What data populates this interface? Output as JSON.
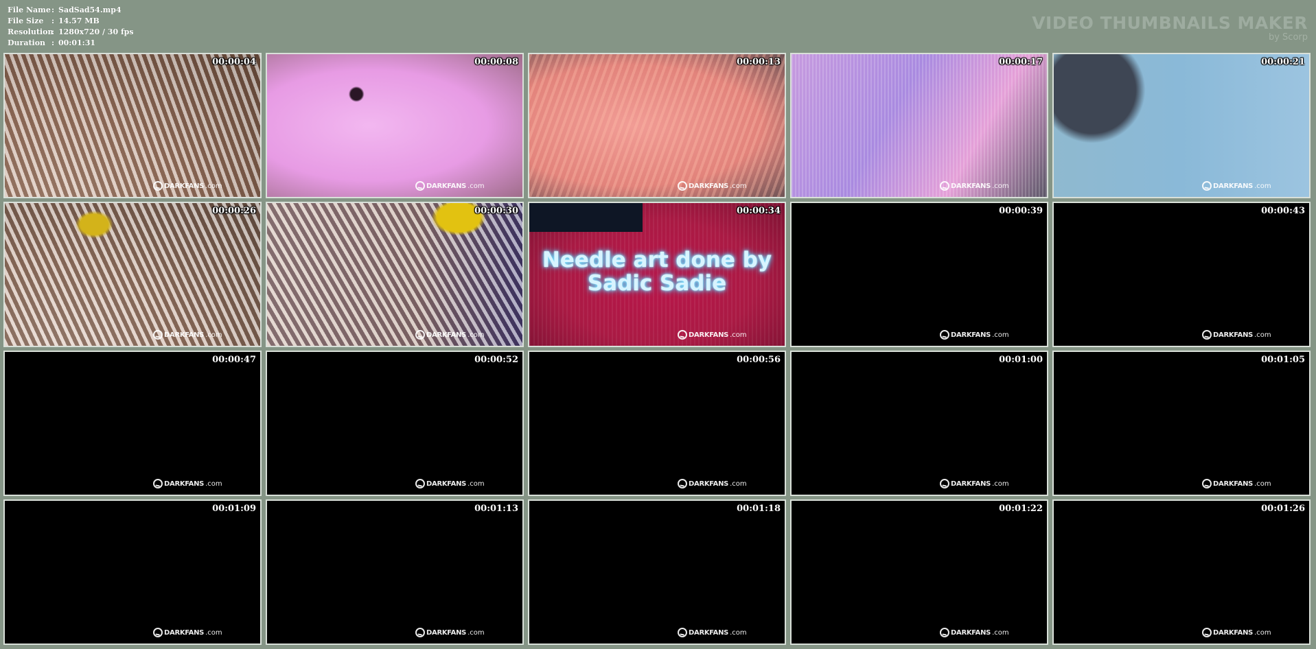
{
  "info": [
    {
      "key": "File Name",
      "sep": ":",
      "value": "SadSad54.mp4"
    },
    {
      "key": "File Size",
      "sep": ":",
      "value": "14.57 MB"
    },
    {
      "key": "Resolution",
      "sep": ":",
      "value": "1280x720 / 30 fps"
    },
    {
      "key": "Duration",
      "sep": ":",
      "value": "00:01:31"
    }
  ],
  "brand": {
    "title": "VIDEO THUMBNAILS MAKER",
    "subtitle": "by Scorp"
  },
  "watermark": {
    "dark": "DARKFANS",
    "rest": ".com"
  },
  "caption": {
    "line1": "Needle art done by",
    "line2": "Sadic Sadie"
  },
  "thumbnails": [
    {
      "time": "00:00:04"
    },
    {
      "time": "00:00:08"
    },
    {
      "time": "00:00:13"
    },
    {
      "time": "00:00:17"
    },
    {
      "time": "00:00:21"
    },
    {
      "time": "00:00:26"
    },
    {
      "time": "00:00:30"
    },
    {
      "time": "00:00:34"
    },
    {
      "time": "00:00:39"
    },
    {
      "time": "00:00:43"
    },
    {
      "time": "00:00:47"
    },
    {
      "time": "00:00:52"
    },
    {
      "time": "00:00:56"
    },
    {
      "time": "00:01:00"
    },
    {
      "time": "00:01:05"
    },
    {
      "time": "00:01:09"
    },
    {
      "time": "00:01:13"
    },
    {
      "time": "00:01:18"
    },
    {
      "time": "00:01:22"
    },
    {
      "time": "00:01:26"
    }
  ]
}
